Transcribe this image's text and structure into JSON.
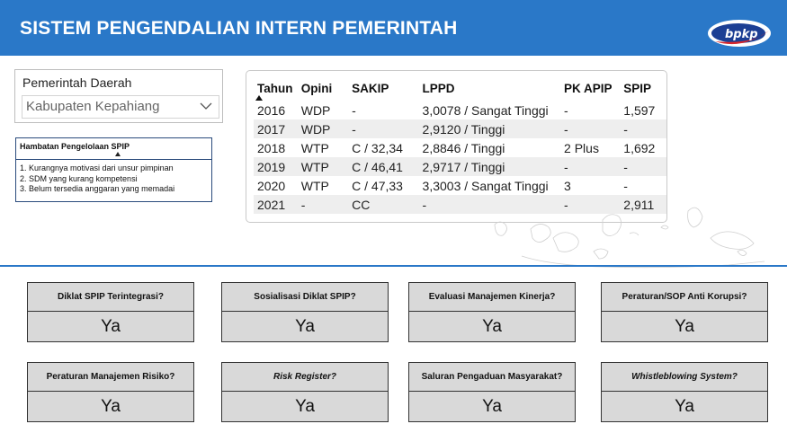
{
  "header": {
    "title": "SISTEM PENGENDALIAN INTERN PEMERINTAH",
    "logo_text": "bpkp",
    "background_color": "#2a78c8"
  },
  "region": {
    "label": "Pemerintah Daerah",
    "selected": "Kabupaten Kepahiang"
  },
  "obstacles": {
    "title": "Hambatan Pengelolaan SPIP",
    "items": [
      "1. Kurangnya motivasi dari unsur pimpinan",
      "2. SDM yang kurang kompetensi",
      "3. Belum tersedia anggaran yang memadai"
    ]
  },
  "table": {
    "columns": [
      "Tahun",
      "Opini",
      "SAKIP",
      "LPPD",
      "PK APIP",
      "SPIP"
    ],
    "rows": [
      [
        "2016",
        "WDP",
        "-",
        "3,0078 / Sangat Tinggi",
        "-",
        "1,597"
      ],
      [
        "2017",
        "WDP",
        "-",
        "2,9120 / Tinggi",
        "-",
        "-"
      ],
      [
        "2018",
        "WTP",
        "C / 32,34",
        "2,8846 / Tinggi",
        "2 Plus",
        "1,692"
      ],
      [
        "2019",
        "WTP",
        "C / 46,41",
        "2,9717 / Tinggi",
        "-",
        "-"
      ],
      [
        "2020",
        "WTP",
        "C / 47,33",
        "3,3003 / Sangat Tinggi",
        "3",
        "-"
      ],
      [
        "2021",
        "-",
        "CC",
        "-",
        "-",
        "2,911"
      ]
    ]
  },
  "cards": [
    {
      "label": "Diklat SPIP Terintegrasi?",
      "value": "Ya",
      "italic": false
    },
    {
      "label": "Sosialisasi Diklat SPIP?",
      "value": "Ya",
      "italic": false
    },
    {
      "label": "Evaluasi Manajemen Kinerja?",
      "value": "Ya",
      "italic": false
    },
    {
      "label": "Peraturan/SOP Anti Korupsi?",
      "value": "Ya",
      "italic": false
    },
    {
      "label": "Peraturan Manajemen Risiko?",
      "value": "Ya",
      "italic": false
    },
    {
      "label": "Risk Register?",
      "value": "Ya",
      "italic": true
    },
    {
      "label": "Saluran Pengaduan Masyarakat?",
      "value": "Ya",
      "italic": false
    },
    {
      "label": "Whistleblowing System?",
      "value": "Ya",
      "italic": true
    }
  ]
}
